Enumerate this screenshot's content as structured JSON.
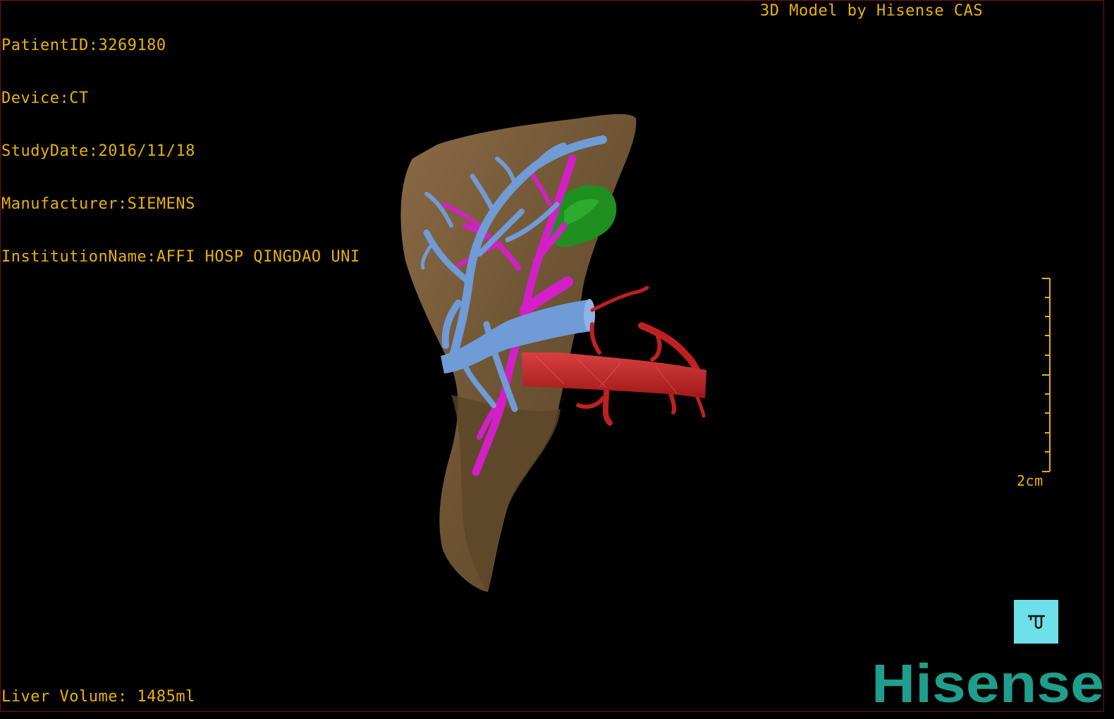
{
  "info": {
    "patient_id": "PatientID:3269180",
    "device": "Device:CT",
    "study_date": "StudyDate:2016/11/18",
    "manufacturer": "Manufacturer:SIEMENS",
    "institution": "InstitutionName:AFFI HOSP QINGDAO UNI"
  },
  "credit": "3D Model by Hisense CAS",
  "liver_volume": "Liver Volume: 1485ml",
  "scale": {
    "label": "2cm"
  },
  "logo": {
    "text": "Hisense",
    "color": "#1f9e8c"
  },
  "view_button": {
    "icon": "orientation-cube-icon",
    "color": "#6de0ea"
  },
  "colors": {
    "overlay_text": "#e9b200",
    "liver": "#7a5c3a",
    "portal_vein": "#6f9bd6",
    "hepatic_vein": "#d21fc8",
    "artery": "#c02020",
    "tumor": "#1f8f1f"
  }
}
